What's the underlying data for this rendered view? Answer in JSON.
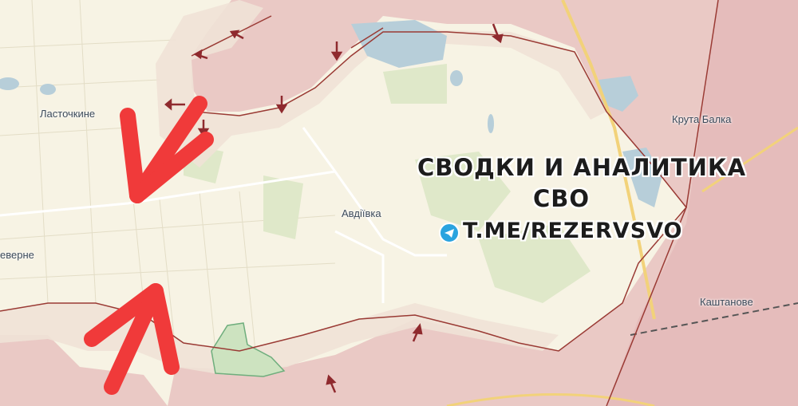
{
  "map": {
    "labels": {
      "lastochkyne": "Ласточкине",
      "avdiivka": "Авдіївка",
      "sieverne": "еверне",
      "kruta_balka": "Крута Балка",
      "kashtanove": "Каштанове"
    },
    "watermark": {
      "line1": "СВОДКИ И АНАЛИТИКА",
      "line2": "СВО",
      "link": "T.ME/REZERVSVO",
      "icon": "telegram-icon"
    },
    "colors": {
      "land": "#f7f3e4",
      "occupied": "#eac9c5",
      "occupied_deep": "#e2b7b6",
      "contested": "#efe2d6",
      "frontline": "#9a3a34",
      "attack_arrow": "#f03a3a",
      "small_arrow": "#8f2a2e",
      "water": "#b7ced9",
      "forest": "#dfe8c9",
      "road_yellow": "#f2d27a",
      "railway": "#555555"
    }
  }
}
